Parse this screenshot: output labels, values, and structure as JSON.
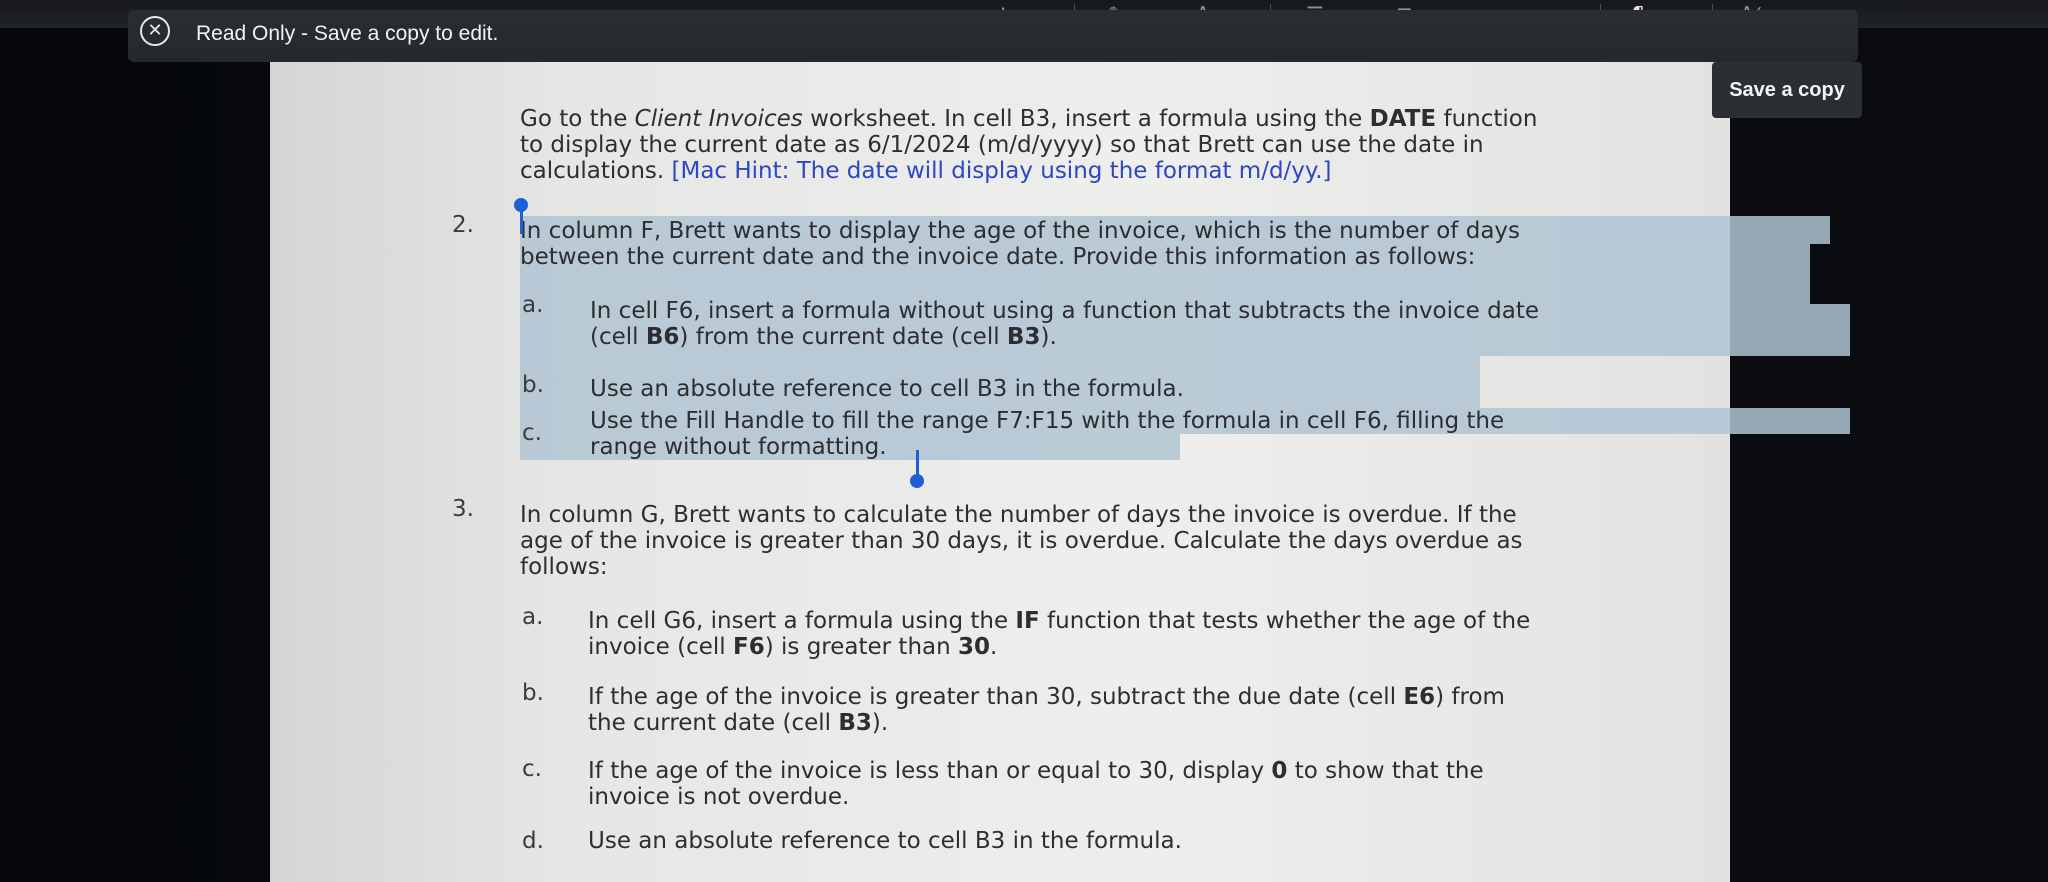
{
  "toolbar": {
    "icons": [
      "text-size-icon",
      "highlight-icon",
      "font-color-icon",
      "bullets-icon",
      "numbering-icon",
      "decrease-indent-icon",
      "increase-indent-icon",
      "paragraph-icon",
      "styles-icon"
    ]
  },
  "notice": {
    "text": "Read Only - Save a copy to edit."
  },
  "save_copy": {
    "label": "Save a copy"
  },
  "document": {
    "intro": {
      "line1_a": "Go to the ",
      "line1_italic": "Client Invoices",
      "line1_b": " worksheet. In cell B3, insert a formula using the ",
      "line1_bold": "DATE",
      "line1_c": " function",
      "line2": "to display the current date as 6/1/2024 (m/d/yyyy) so that Brett can use the date in",
      "line3_a": "calculations. ",
      "line3_hint": "[Mac Hint: The date will display using the format m/d/yy.]"
    },
    "item2": {
      "number": "2.",
      "line1": "In column F, Brett wants to display the age of the invoice, which is the number of days",
      "line2": "between the current date and the invoice date. Provide this information as follows:",
      "a_letter": "a.",
      "a_line1": "In cell F6, insert a formula without using a function that subtracts the invoice date",
      "a_line2_a": "(cell ",
      "a_line2_b1": "B6",
      "a_line2_c": ") from the current date (cell ",
      "a_line2_b2": "B3",
      "a_line2_d": ").",
      "b_letter": "b.",
      "b_text": "Use an absolute reference to cell B3 in the formula.",
      "c_letter": "c.",
      "c_line1": "Use the Fill Handle to fill the range F7:F15 with the formula in cell F6, filling the",
      "c_line2": "range without formatting."
    },
    "item3": {
      "number": "3.",
      "line1": "In column G, Brett wants to calculate the number of days the invoice is overdue. If the",
      "line2": "age of the invoice is greater than 30 days, it is overdue. Calculate the days overdue as",
      "line3": "follows:",
      "a_letter": "a.",
      "a_line1_a": "In cell G6, insert a formula using the ",
      "a_line1_bold": "IF",
      "a_line1_b": " function that tests whether the age of the",
      "a_line2_a": "invoice (cell ",
      "a_line2_b1": "F6",
      "a_line2_c": ") is greater than ",
      "a_line2_b2": "30",
      "a_line2_d": ".",
      "b_letter": "b.",
      "b_line1_a": "If the age of the invoice is greater than 30, subtract the due date (cell ",
      "b_line1_bold": "E6",
      "b_line1_b": ") from",
      "b_line2_a": "the current date (cell ",
      "b_line2_bold": "B3",
      "b_line2_b": ").",
      "c_letter": "c.",
      "c_line1_a": "If the age of the invoice is less than or equal to 30, display ",
      "c_line1_bold": "0",
      "c_line1_b": " to show that the",
      "c_line2": "invoice is not overdue.",
      "d_letter": "d.",
      "d_text": "Use an absolute reference to cell B3 in the formula."
    }
  },
  "colors": {
    "selection": "#b0c4d2",
    "selection_handle": "#1f5fd6",
    "hint_text": "#2e47c0"
  }
}
